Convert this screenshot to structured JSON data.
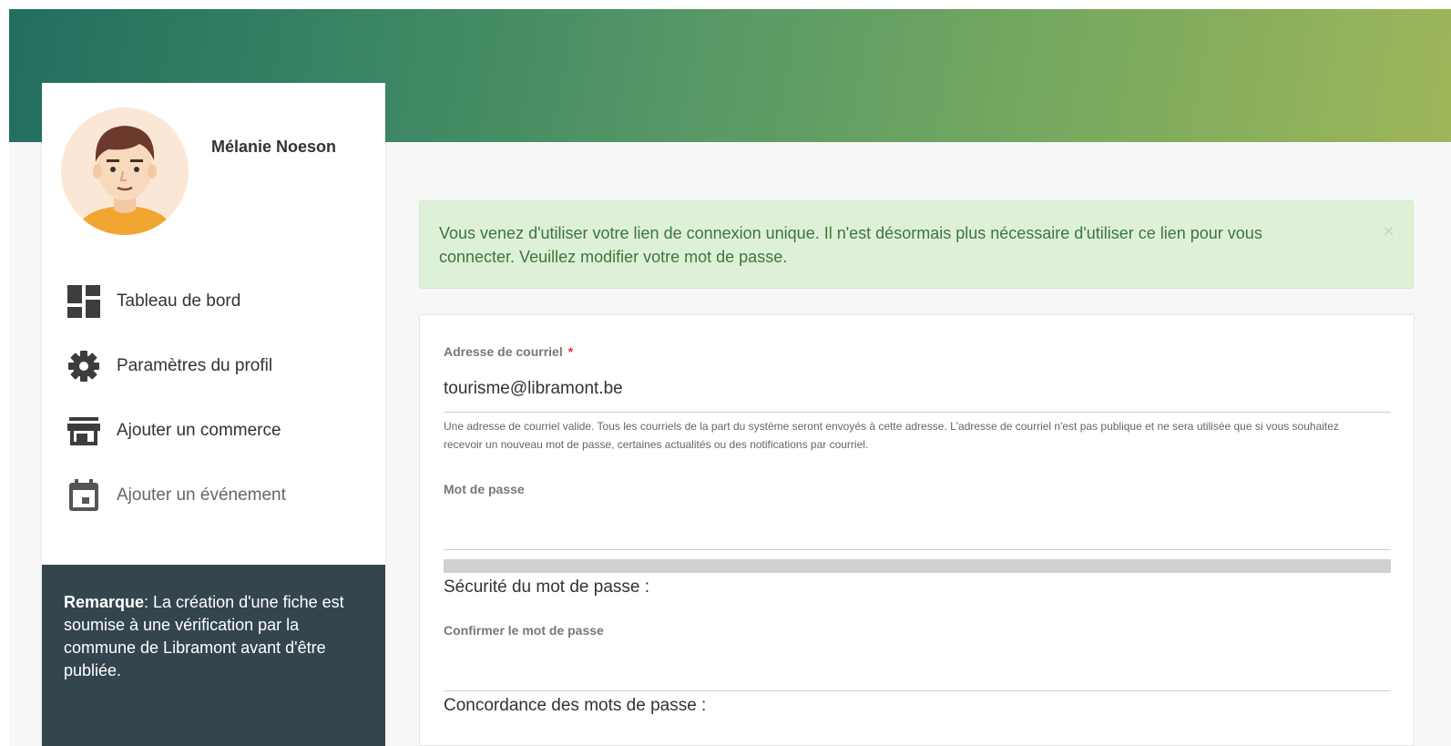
{
  "colors": {
    "hero_start": "#226e5f",
    "hero_end": "#9fb65a",
    "sidebar_note_bg": "#34454e",
    "alert_bg": "#dff0d8",
    "alert_text": "#3c763d",
    "required": "#dd3333"
  },
  "user": {
    "name": "Mélanie Noeson",
    "avatar_icon": "avatar-illustration"
  },
  "sidebar": {
    "items": [
      {
        "label": "Tableau de bord",
        "icon": "dashboard-icon"
      },
      {
        "label": "Paramètres du profil",
        "icon": "gear-icon"
      },
      {
        "label": "Ajouter un commerce",
        "icon": "store-icon"
      },
      {
        "label": "Ajouter un événement",
        "icon": "calendar-icon"
      }
    ],
    "note": {
      "bold": "Remarque",
      "text": ": La création d'une fiche est soumise à une vérification par la commune de Libramont avant d'être publiée."
    }
  },
  "alert": {
    "message": "Vous venez d'utiliser votre lien de connexion unique. Il n'est désormais plus nécessaire d'utiliser ce lien pour vous connecter. Veuillez modifier votre mot de passe.",
    "close_symbol": "×"
  },
  "form": {
    "email": {
      "label": "Adresse de courriel",
      "required_marker": "*",
      "value": "tourisme@libramont.be",
      "help": "Une adresse de courriel valide. Tous les courriels de la part du système seront envoyés à cette adresse. L'adresse de courriel n'est pas publique et ne sera utilisée que si vous souhaitez recevoir un nouveau mot de passe, certaines actualités ou des notifications par courriel."
    },
    "password": {
      "label": "Mot de passe",
      "value": "",
      "strength_label": "Sécurité du mot de passe :"
    },
    "confirm": {
      "label": "Confirmer le mot de passe",
      "value": "",
      "match_label": "Concordance des mots de passe :"
    }
  }
}
